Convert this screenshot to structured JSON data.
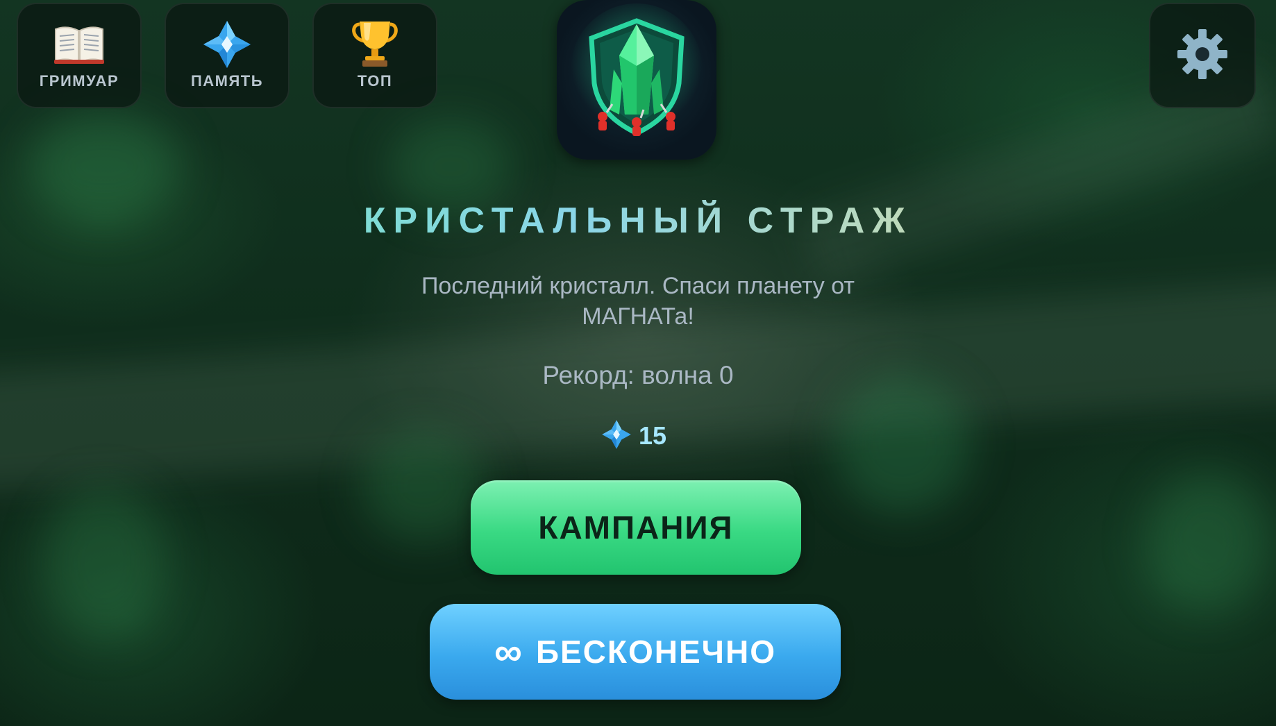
{
  "top_nav": {
    "grimoire": {
      "label": "ГРИМУАР",
      "icon": "open-book-icon"
    },
    "memory": {
      "label": "ПАМЯТЬ",
      "icon": "blue-crystal-icon"
    },
    "top": {
      "label": "ТОП",
      "icon": "trophy-icon"
    },
    "settings": {
      "icon": "gear-icon"
    }
  },
  "logo": {
    "icon": "crystal-shield-logo"
  },
  "game": {
    "title": "КРИСТАЛЬНЫЙ СТРАЖ",
    "subtitle": "Последний кристалл. Спаси планету от МАГНАТа!",
    "record": "Рекорд: волна 0"
  },
  "currency": {
    "icon": "blue-crystal-icon",
    "amount": "15"
  },
  "buttons": {
    "campaign": "КАМПАНИЯ",
    "endless_symbol": "∞",
    "endless": "БЕСКОНЕЧНО"
  },
  "colors": {
    "background": "#0f2d1c",
    "campaign_button": "#39d983",
    "endless_button": "#3aa9ee",
    "title_gradient_start": "#6de6b4",
    "title_gradient_end": "#e8d88a",
    "currency_text": "#a6e7ff"
  }
}
